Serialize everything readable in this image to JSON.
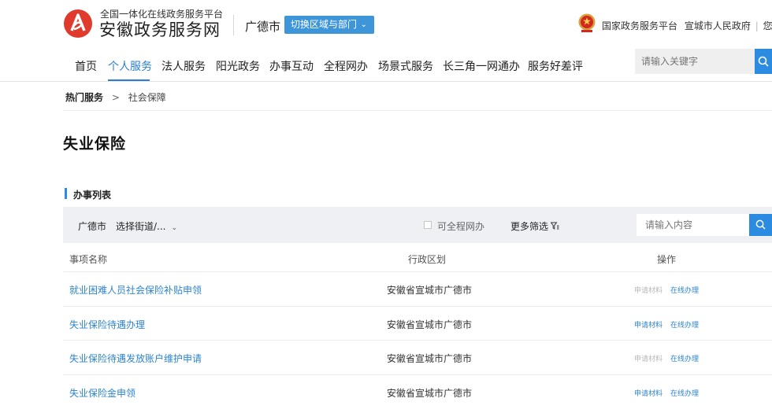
{
  "header": {
    "platform_subtitle": "全国一体化在线政务服务平台",
    "site_name": "安徽政务服务网",
    "city": "广德市",
    "switch_button": "切换区域与部门",
    "links": [
      "国家政务服务平台",
      "宣城市人民政府",
      "您好，"
    ],
    "brand_color": "#e03a2c",
    "accent_color": "#3e95d8"
  },
  "nav": {
    "items": [
      "首页",
      "个人服务",
      "法人服务",
      "阳光政务",
      "办事互动",
      "全程网办",
      "场景式服务",
      "长三角一网通办",
      "服务好差评"
    ],
    "active_index": 1,
    "search_placeholder": "请输入关键字"
  },
  "breadcrumb": {
    "parent": "热门服务",
    "separator": ">",
    "current": "社会保障"
  },
  "page_title": "失业保险",
  "section": {
    "title": "办事列表",
    "filters": {
      "city": "广德市",
      "street_select": "选择街道/...",
      "fullonline_checkbox_label": "可全程网办",
      "fullonline_checked": false,
      "more_filters": "更多筛选",
      "search_placeholder": "请输入内容"
    },
    "table": {
      "columns": [
        "事项名称",
        "行政区划",
        "操作"
      ],
      "rows": [
        {
          "name": "就业困难人员社会保险补贴申领",
          "region": "安徽省宣城市广德市",
          "materials": "申请材料",
          "materials_enabled": false,
          "online": "在线办理"
        },
        {
          "name": "失业保险待遇办理",
          "region": "安徽省宣城市广德市",
          "materials": "申请材料",
          "materials_enabled": true,
          "online": "在线办理"
        },
        {
          "name": "失业保险待遇发放账户维护申请",
          "region": "安徽省宣城市广德市",
          "materials": "申请材料",
          "materials_enabled": false,
          "online": "在线办理"
        },
        {
          "name": "失业保险金申领",
          "region": "安徽省宣城市广德市",
          "materials": "申请材料",
          "materials_enabled": true,
          "online": "在线办理"
        }
      ]
    }
  }
}
